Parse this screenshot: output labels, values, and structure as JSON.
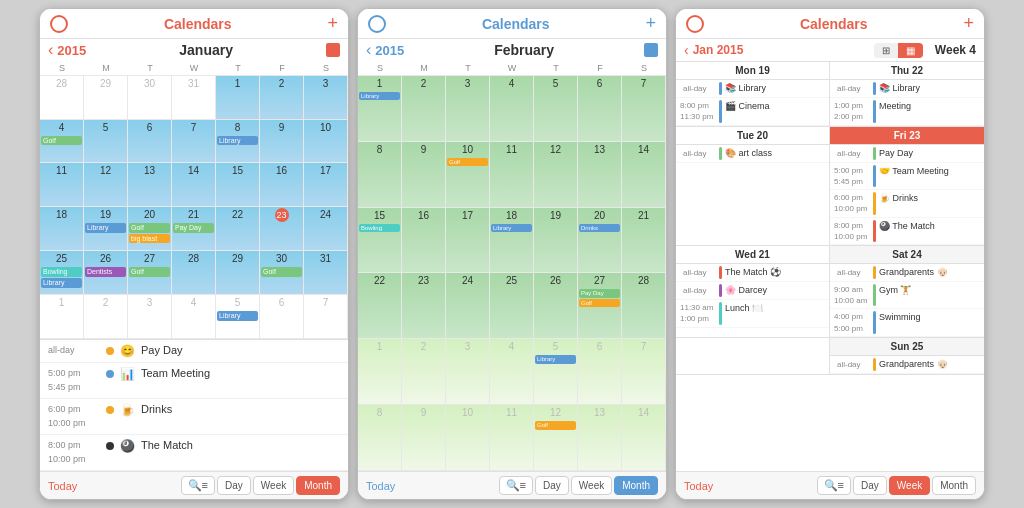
{
  "phones": [
    {
      "id": "phone1",
      "nav": {
        "title": "Calendars",
        "plus": "+",
        "circle": true
      },
      "cal_header": {
        "arrow": "‹",
        "year": "2015",
        "month": "January"
      },
      "day_headers": [
        "S",
        "M",
        "T",
        "W",
        "T",
        "F",
        "S"
      ],
      "weeks": [
        [
          {
            "d": "28",
            "other": true
          },
          {
            "d": "29",
            "other": true
          },
          {
            "d": "30",
            "other": true
          },
          {
            "d": "31",
            "other": true
          },
          {
            "d": "1",
            "sky": true
          },
          {
            "d": "2",
            "sky": true
          },
          {
            "d": "3",
            "sky": true
          }
        ],
        [
          {
            "d": "4",
            "sky": true,
            "events": [
              {
                "label": "Golf",
                "cls": "event-green"
              }
            ]
          },
          {
            "d": "5",
            "sky": true
          },
          {
            "d": "6",
            "sky": true
          },
          {
            "d": "7",
            "sky": true
          },
          {
            "d": "8",
            "sky": true,
            "events": [
              {
                "label": "Library",
                "cls": "event-blue"
              }
            ]
          },
          {
            "d": "9",
            "sky": true
          },
          {
            "d": "10",
            "sky": true
          }
        ],
        [
          {
            "d": "11",
            "sky": true
          },
          {
            "d": "12",
            "sky": true
          },
          {
            "d": "13",
            "sky": true
          },
          {
            "d": "14",
            "sky": true
          },
          {
            "d": "15",
            "sky": true
          },
          {
            "d": "16",
            "sky": true
          },
          {
            "d": "17",
            "sky": true
          }
        ],
        [
          {
            "d": "18",
            "sky": true
          },
          {
            "d": "19",
            "sky": true,
            "events": [
              {
                "label": "Library",
                "cls": "event-blue"
              }
            ]
          },
          {
            "d": "20",
            "sky": true,
            "events": [
              {
                "label": "Golf",
                "cls": "event-green"
              },
              {
                "label": "big blast",
                "cls": "event-orange"
              }
            ]
          },
          {
            "d": "21",
            "sky": true,
            "events": [
              {
                "label": "Pay Day",
                "cls": "event-green"
              }
            ]
          },
          {
            "d": "22",
            "sky": true
          },
          {
            "d": "23",
            "sky": true,
            "today": true
          },
          {
            "d": "24",
            "sky": true
          }
        ],
        [
          {
            "d": "25",
            "sky": true,
            "events": [
              {
                "label": "Bowling",
                "cls": "event-teal"
              },
              {
                "label": "Library",
                "cls": "event-blue"
              }
            ]
          },
          {
            "d": "26",
            "sky": true,
            "events": [
              {
                "label": "Dentists",
                "cls": "event-purple"
              }
            ]
          },
          {
            "d": "27",
            "sky": true,
            "events": [
              {
                "label": "Golf",
                "cls": "event-green"
              }
            ]
          },
          {
            "d": "28",
            "sky": true
          },
          {
            "d": "29",
            "sky": true
          },
          {
            "d": "30",
            "sky": true,
            "events": [
              {
                "label": "Golf",
                "cls": "event-green"
              }
            ]
          },
          {
            "d": "31",
            "sky": true
          }
        ],
        [
          {
            "d": "1",
            "other": true
          },
          {
            "d": "2",
            "other": true
          },
          {
            "d": "3",
            "other": true
          },
          {
            "d": "4",
            "other": true
          },
          {
            "d": "5",
            "other": true,
            "events": [
              {
                "label": "Library",
                "cls": "event-blue"
              }
            ]
          },
          {
            "d": "6",
            "other": true
          },
          {
            "d": "7",
            "other": true
          }
        ]
      ],
      "events": [
        {
          "time_top": "all-day",
          "time_bot": "",
          "dot_color": "#f5a623",
          "icon": "😊",
          "name": "Pay Day"
        },
        {
          "time_top": "5:00 pm",
          "time_bot": "5:45 pm",
          "dot_color": "#5b9bd5",
          "icon": "📊",
          "name": "Team Meeting"
        },
        {
          "time_top": "6:00 pm",
          "time_bot": "10:00 pm",
          "dot_color": "#f5a623",
          "icon": "🍺",
          "name": "Drinks"
        },
        {
          "time_top": "8:00 pm",
          "time_bot": "10:00 pm",
          "dot_color": "#333",
          "icon": "🎱",
          "name": "The Match"
        }
      ],
      "bottom": {
        "today": "Today",
        "search": "🔍≡",
        "day": "Day",
        "week": "Week",
        "month": "Month",
        "active": "month"
      }
    },
    {
      "id": "phone2",
      "nav": {
        "title": "Calendars",
        "plus": "+",
        "circle": true
      },
      "cal_header": {
        "arrow": "‹",
        "year": "2015",
        "month": "February"
      },
      "day_headers": [
        "S",
        "M",
        "T",
        "W",
        "T",
        "F",
        "S"
      ],
      "bottom": {
        "today": "Today",
        "search": "🔍≡",
        "day": "Day",
        "week": "Week",
        "month": "Month",
        "active": "month"
      }
    },
    {
      "id": "phone3",
      "nav": {
        "title": "Calendars",
        "plus": "+"
      },
      "week_header": {
        "arrow": "‹",
        "year": "Jan 2015",
        "week": "Week 4"
      },
      "days": [
        {
          "label": "Mon 19",
          "col": "left",
          "events": [
            {
              "allday": true,
              "name": "📚 Library"
            },
            {
              "time": "8:00 pm",
              "time2": "11:30 pm",
              "name": "🎬 Cinema",
              "bar": "blue"
            }
          ]
        },
        {
          "label": "Thu 22",
          "col": "right",
          "events": [
            {
              "allday": true,
              "name": "📚 Library"
            },
            {
              "time": "1:00 pm",
              "time2": "2:00 pm",
              "name": "Meeting",
              "bar": "blue"
            }
          ]
        },
        {
          "label": "Tue 20",
          "col": "left",
          "events": [
            {
              "allday": true,
              "name": "🎨 art class"
            }
          ]
        },
        {
          "label": "Fri 23",
          "col": "right",
          "highlight": true,
          "events": [
            {
              "allday": true,
              "name": "Pay Day"
            },
            {
              "time": "5:00 pm",
              "time2": "5:45 pm",
              "name": "🤝 Team Meeting",
              "bar": "blue"
            },
            {
              "time": "6:00 pm",
              "time2": "10:00 pm",
              "name": "🍺 Drinks",
              "bar": "orange"
            },
            {
              "time": "8:00 pm",
              "time2": "10:00 pm",
              "name": "🎱 The Match",
              "bar": "red"
            }
          ]
        },
        {
          "label": "Wed 21",
          "col": "left",
          "events": [
            {
              "allday": true,
              "name": "The Match ⚽"
            },
            {
              "allday": true,
              "name": "🌸 Darcey"
            },
            {
              "time": "11:30 am",
              "time2": "1:00 pm",
              "name": "Lunch 🍽️",
              "bar": "green"
            }
          ]
        },
        {
          "label": "Sat 24",
          "col": "right",
          "events": [
            {
              "allday": true,
              "name": "Grandparents 👴🏻"
            },
            {
              "time": "9:00 am",
              "time2": "10:00 am",
              "name": "Gym 🏋️",
              "bar": "green"
            },
            {
              "time": "4:00 pm",
              "time2": "5:00 pm",
              "name": "Swimming",
              "bar": "blue"
            }
          ]
        },
        {
          "label": "Sun 25",
          "col": "right_full",
          "events": [
            {
              "allday": true,
              "name": "Grandparents 👴🏻"
            }
          ]
        }
      ],
      "bottom": {
        "today": "Today",
        "search": "🔍≡",
        "day": "Day",
        "week": "Week",
        "month": "Month",
        "active": "week"
      }
    }
  ]
}
